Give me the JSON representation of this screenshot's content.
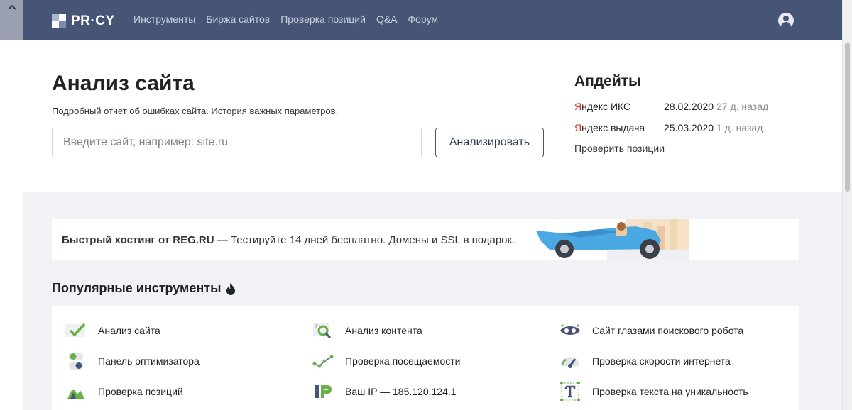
{
  "header": {
    "logo_text": "PR·CY",
    "nav": [
      "Инструменты",
      "Биржа сайтов",
      "Проверка позиций",
      "Q&A",
      "Форум"
    ]
  },
  "hero": {
    "title": "Анализ сайта",
    "subtitle": "Подробный отчет об ошибках сайта. История важных параметров.",
    "search_placeholder": "Введите сайт, например: site.ru",
    "search_value": "",
    "analyze_label": "Анализировать"
  },
  "updates": {
    "title": "Апдейты",
    "rows": [
      {
        "prefix": "Я",
        "name": "ндекс ИКС",
        "date": "28.02.2020",
        "ago": "27 д. назад"
      },
      {
        "prefix": "Я",
        "name": "ндекс выдача",
        "date": "25.03.2020",
        "ago": "1 д. назад"
      }
    ],
    "check_link": "Проверить позиции"
  },
  "ad": {
    "bold": "Быстрый хостинг от REG.RU",
    "rest": " — Тестируйте 14 дней бесплатно. Домены и SSL в подарок."
  },
  "popular": {
    "title": "Популярные инструменты",
    "tools": [
      {
        "label": "Анализ сайта",
        "icon": "checkmark-icon"
      },
      {
        "label": "Анализ контента",
        "icon": "magnifier-icon"
      },
      {
        "label": "Сайт глазами поискового робота",
        "icon": "robot-eyes-icon"
      },
      {
        "label": "Панель оптимизатора",
        "icon": "toggle-panel-icon"
      },
      {
        "label": "Проверка посещаемости",
        "icon": "line-graph-icon"
      },
      {
        "label": "Проверка скорости интернета",
        "icon": "speedometer-icon"
      },
      {
        "label": "Проверка позиций",
        "icon": "mountains-icon"
      },
      {
        "label": "Ваш IP — 185.120.124.1",
        "icon": "ip-icon"
      },
      {
        "label": "Проверка текста на уникальность",
        "icon": "text-t-icon"
      }
    ]
  },
  "colors": {
    "header_bg": "#465575",
    "accent_green": "#6ab04c",
    "yandex_red": "#e02d1b"
  }
}
